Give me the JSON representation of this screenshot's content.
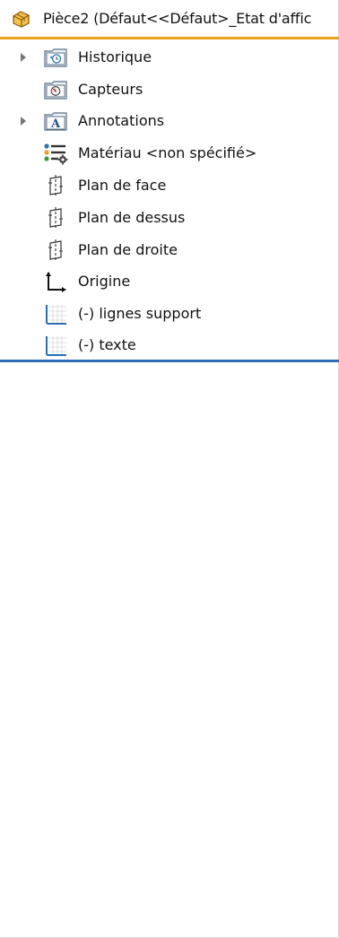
{
  "header": {
    "title": "Pièce2  (Défaut<<Défaut>_Etat d'affic",
    "icon": "part-icon",
    "accent_color": "#e8a21c"
  },
  "tree": {
    "items": [
      {
        "label": "Historique",
        "icon": "history-folder-icon",
        "expandable": true
      },
      {
        "label": "Capteurs",
        "icon": "sensors-folder-icon",
        "expandable": false
      },
      {
        "label": "Annotations",
        "icon": "annotations-folder-icon",
        "expandable": true
      },
      {
        "label": "Matériau <non spécifié>",
        "icon": "material-icon",
        "expandable": false
      },
      {
        "label": "Plan de face",
        "icon": "plane-icon",
        "expandable": false
      },
      {
        "label": "Plan de dessus",
        "icon": "plane-icon",
        "expandable": false
      },
      {
        "label": "Plan de droite",
        "icon": "plane-icon",
        "expandable": false
      },
      {
        "label": "Origine",
        "icon": "origin-icon",
        "expandable": false
      },
      {
        "label": "(-) lignes support",
        "icon": "sketch-icon",
        "expandable": false
      },
      {
        "label": "(-) texte",
        "icon": "sketch-icon",
        "expandable": false
      }
    ]
  },
  "rollback_bar": {
    "color": "#2a6fb8"
  }
}
